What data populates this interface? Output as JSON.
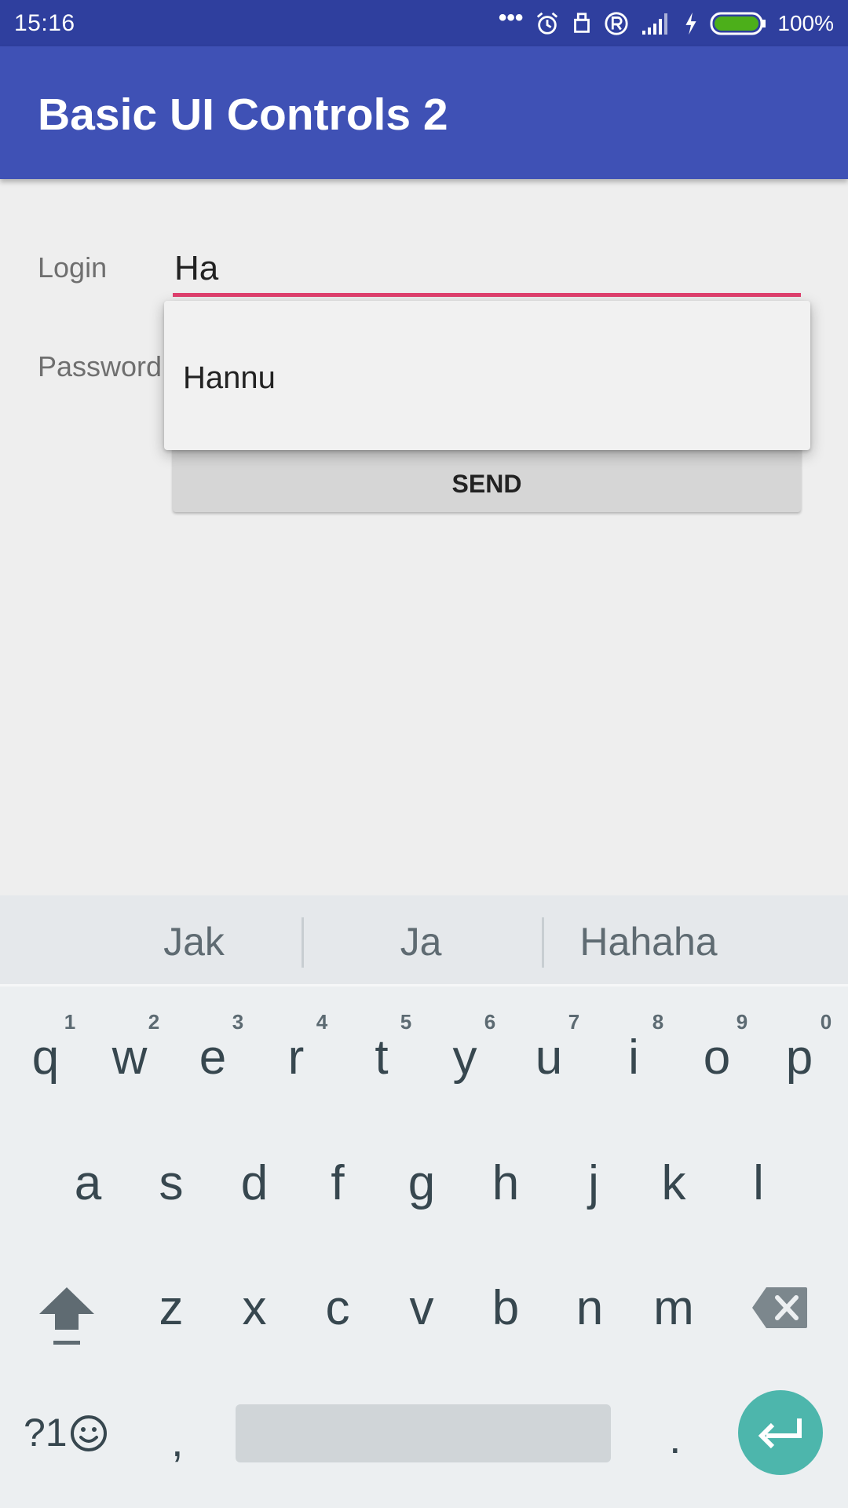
{
  "status_bar": {
    "time": "15:16",
    "dots": "•••",
    "battery_percent": "100%",
    "battery_color": "#4caf1a",
    "icons": [
      "more-dots-icon",
      "alarm-icon",
      "usb-icon",
      "registered-icon",
      "signal-icon",
      "charging-icon",
      "battery-icon"
    ]
  },
  "app_bar": {
    "title": "Basic UI Controls 2",
    "color": "#3f51b5"
  },
  "form": {
    "login_label": "Login",
    "login_value": "Ha",
    "password_label": "Password",
    "send_label": "SEND",
    "accent_color": "#e0406e"
  },
  "autocomplete": {
    "items": [
      "Hannu"
    ]
  },
  "keyboard": {
    "suggestions": [
      "Jak",
      "Ja",
      "Hahaha"
    ],
    "row1": [
      "q",
      "w",
      "e",
      "r",
      "t",
      "y",
      "u",
      "i",
      "o",
      "p"
    ],
    "row1_hints": [
      "1",
      "2",
      "3",
      "4",
      "5",
      "6",
      "7",
      "8",
      "9",
      "0"
    ],
    "row2": [
      "a",
      "s",
      "d",
      "f",
      "g",
      "h",
      "j",
      "k",
      "l"
    ],
    "row3": [
      "z",
      "x",
      "c",
      "v",
      "b",
      "n",
      "m"
    ],
    "symbols_label": "?1",
    "comma": ",",
    "period": ".",
    "enter_color": "#4db6ac"
  }
}
